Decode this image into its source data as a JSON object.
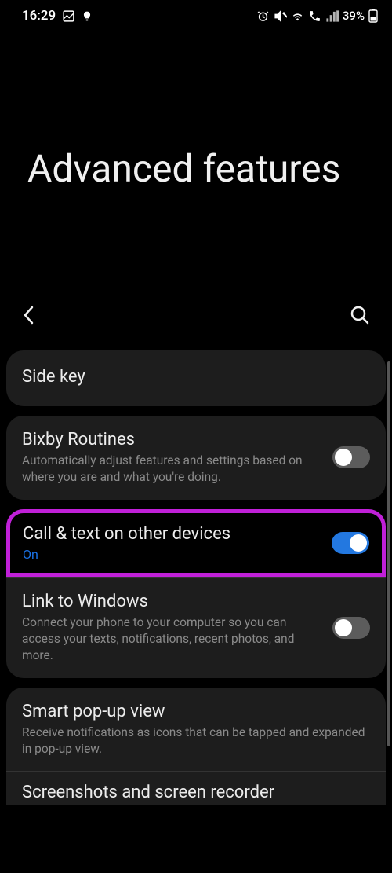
{
  "status_bar": {
    "time": "16:29",
    "battery_percent": "39%"
  },
  "page_title": "Advanced features",
  "items": {
    "side_key": {
      "title": "Side key"
    },
    "bixby": {
      "title": "Bixby Routines",
      "description": "Automatically adjust features and settings based on where you are and what you're doing."
    },
    "call_text": {
      "title": "Call & text on other devices",
      "status": "On"
    },
    "link_windows": {
      "title": "Link to Windows",
      "description": "Connect your phone to your computer so you can access your texts, notifications, recent photos, and more."
    },
    "popup": {
      "title": "Smart pop-up view",
      "description": "Receive notifications as icons that can be tapped and expanded in pop-up view."
    },
    "screenshots": {
      "title": "Screenshots and screen recorder"
    }
  }
}
